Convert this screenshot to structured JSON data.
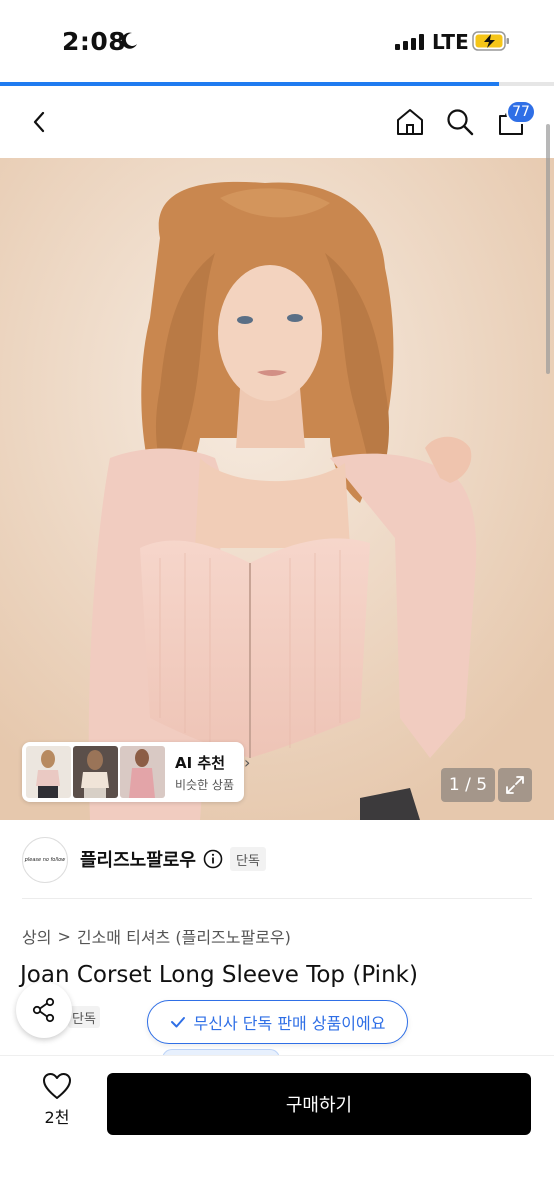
{
  "status_bar": {
    "time": "2:08",
    "network": "LTE"
  },
  "page_progress": 0.9,
  "nav": {
    "cart_count": "77"
  },
  "gallery": {
    "page_indicator": "1 / 5",
    "ai_card": {
      "title": "AI 추천",
      "subtitle": "비슷한 상품"
    }
  },
  "brand": {
    "name": "플리즈노팔로우",
    "logo_text": "please no follow",
    "tag": "단독"
  },
  "breadcrumb": {
    "category": "상의",
    "separator": ">",
    "subcategory": "긴소매 티셔츠 (플리즈노팔로우)"
  },
  "product": {
    "title": "Joan Corset Long Sleeve Top (Pink)",
    "tag": "단독"
  },
  "toast": {
    "message": "무신사 단독 판매 상품이에요"
  },
  "bottom_bar": {
    "like_count": "2천",
    "buy_label": "구매하기"
  },
  "colors": {
    "accent": "#2f6fe6",
    "buy_button": "#000000"
  }
}
